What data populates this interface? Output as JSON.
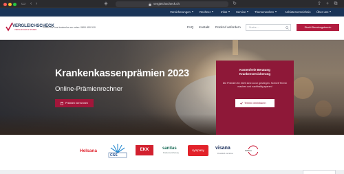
{
  "browser": {
    "url": "vergleichscheck.ch"
  },
  "topnav": {
    "items": [
      {
        "label": "Versicherungen",
        "dropdown": true
      },
      {
        "label": "Rechner",
        "dropdown": true
      },
      {
        "label": "Infos",
        "dropdown": true
      },
      {
        "label": "Service",
        "dropdown": true
      },
      {
        "label": "Themenwelten",
        "dropdown": true
      },
      {
        "label": "Anbieterverzeichnis",
        "dropdown": false
      },
      {
        "label": "Über uns",
        "dropdown": true
      }
    ]
  },
  "header": {
    "logo_text": "VERGLEICHSCHECK",
    "logo_sub": "VERGLEICHEN & SPAREN",
    "hotline": "Rufen Sie uns kostenlos an unter: 0800 400 510",
    "nav": [
      "FAQ",
      "Kontakt",
      "Rückruf anfordern"
    ],
    "search_placeholder": "Suche ...",
    "cta": "Direkt Beratungstermin"
  },
  "hero": {
    "title": "Krankenkassenprämien 2023",
    "subtitle": "Online-Prämienrechner",
    "button": "Prämien berechnen",
    "consult": {
      "title_line1": "Kostenfreie Beratung",
      "title_line2": "Krankenversicherung",
      "text": "Die Prämien für 2023 sind zuvor gestiegen. Schnell Termin machen und nachhaltig sparen!",
      "button": "Termin vereinbaren"
    }
  },
  "partners": {
    "helsana": "Helsana",
    "css": "CSS",
    "ekk": "EKK",
    "sanitas": "sanitas",
    "sanitas_sub": "Krankenversicherung",
    "sympany": "sympany",
    "visana": "visana",
    "visana_sub": "Persönlich und sicher",
    "last": "SWICA"
  },
  "colors": {
    "nav_bg": "#1a3457",
    "brand_red": "#b11c3f",
    "consult_bg": "#8e1838"
  }
}
